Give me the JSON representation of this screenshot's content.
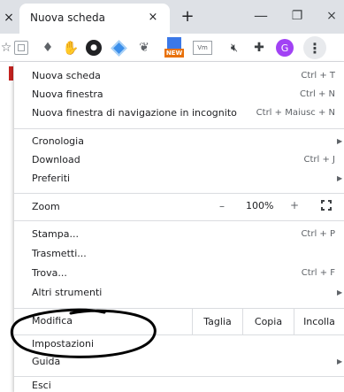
{
  "tabstrip": {
    "strip_close": "×",
    "tab_title": "Nuova scheda",
    "tab_close": "×",
    "new_tab": "+",
    "minimize": "—",
    "maximize": "❐",
    "close": "×"
  },
  "toolbar": {
    "extensions": [
      {
        "icon": "bookmark-star-icon"
      },
      {
        "icon": "frame-icon"
      },
      {
        "icon": "paint-bucket-icon"
      },
      {
        "icon": "thumbs-up-icon"
      },
      {
        "icon": "round-extension-icon"
      },
      {
        "icon": "diamond-icon"
      },
      {
        "icon": "leaf-icon"
      },
      {
        "icon": "new-badge-icon",
        "badge": "NEW"
      },
      {
        "icon": "video-icon",
        "label": "Vm"
      },
      {
        "icon": "mute-icon"
      },
      {
        "icon": "puzzle-icon"
      }
    ],
    "avatar_letter": "G",
    "menu_icon": "⋮",
    "colors": {
      "avatar": "#a142f4",
      "new_badge": "#e8710a",
      "menu_bg": "#e8eaed"
    }
  },
  "menu": {
    "new_tab": {
      "label": "Nuova scheda",
      "shortcut": "Ctrl + T"
    },
    "new_window": {
      "label": "Nuova finestra",
      "shortcut": "Ctrl + N"
    },
    "incognito": {
      "label": "Nuova finestra di navigazione in incognito",
      "shortcut": "Ctrl + Maiusc + N"
    },
    "history": {
      "label": "Cronologia"
    },
    "downloads": {
      "label": "Download",
      "shortcut": "Ctrl + J"
    },
    "bookmarks": {
      "label": "Preferiti"
    },
    "zoom": {
      "label": "Zoom",
      "minus": "–",
      "value": "100%",
      "plus": "+"
    },
    "print": {
      "label": "Stampa...",
      "shortcut": "Ctrl + P"
    },
    "cast": {
      "label": "Trasmetti..."
    },
    "find": {
      "label": "Trova...",
      "shortcut": "Ctrl + F"
    },
    "more_tools": {
      "label": "Altri strumenti"
    },
    "edit": {
      "label": "Modifica",
      "cut": "Taglia",
      "copy": "Copia",
      "paste": "Incolla"
    },
    "settings": {
      "label": "Impostazioni"
    },
    "help": {
      "label": "Guida"
    },
    "exit": {
      "label": "Esci"
    },
    "submenu_arrow": "▶"
  }
}
